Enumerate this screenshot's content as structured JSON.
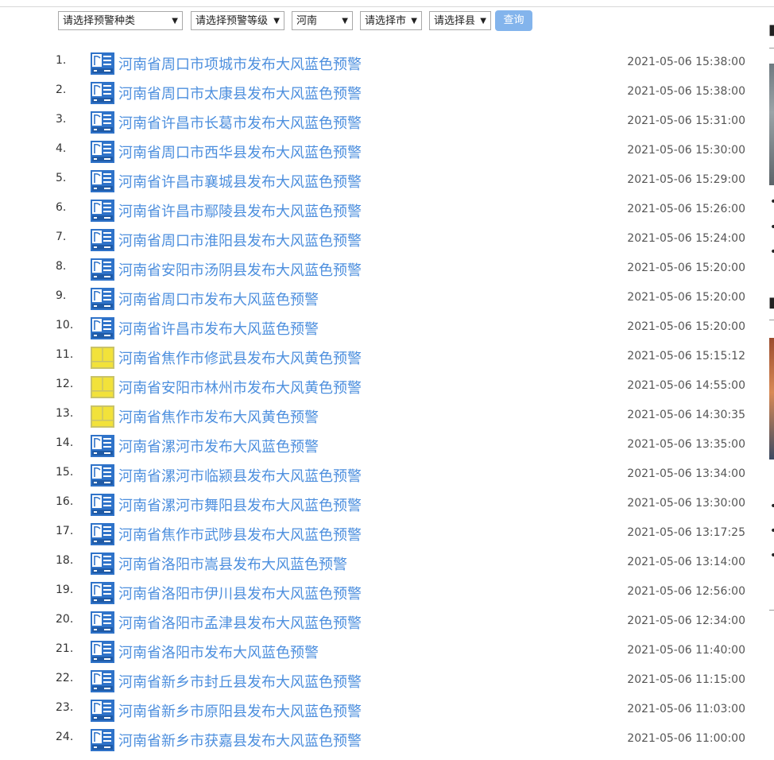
{
  "filters": {
    "type": "请选择预警种类",
    "level": "请选择预警等级",
    "province": "河南",
    "city": "请选择市",
    "county": "请选择县",
    "query_label": "查询"
  },
  "colors": {
    "blue": "#2f73c9",
    "yellow": "#f2e23a",
    "link": "#4d8fde"
  },
  "alerts": [
    {
      "num": "1.",
      "title": "河南省周口市项城市发布大风蓝色预警",
      "time": "2021-05-06 15:38:00",
      "level": "blue"
    },
    {
      "num": "2.",
      "title": "河南省周口市太康县发布大风蓝色预警",
      "time": "2021-05-06 15:38:00",
      "level": "blue"
    },
    {
      "num": "3.",
      "title": "河南省许昌市长葛市发布大风蓝色预警",
      "time": "2021-05-06 15:31:00",
      "level": "blue"
    },
    {
      "num": "4.",
      "title": "河南省周口市西华县发布大风蓝色预警",
      "time": "2021-05-06 15:30:00",
      "level": "blue"
    },
    {
      "num": "5.",
      "title": "河南省许昌市襄城县发布大风蓝色预警",
      "time": "2021-05-06 15:29:00",
      "level": "blue"
    },
    {
      "num": "6.",
      "title": "河南省许昌市鄢陵县发布大风蓝色预警",
      "time": "2021-05-06 15:26:00",
      "level": "blue"
    },
    {
      "num": "7.",
      "title": "河南省周口市淮阳县发布大风蓝色预警",
      "time": "2021-05-06 15:24:00",
      "level": "blue"
    },
    {
      "num": "8.",
      "title": "河南省安阳市汤阴县发布大风蓝色预警",
      "time": "2021-05-06 15:20:00",
      "level": "blue"
    },
    {
      "num": "9.",
      "title": "河南省周口市发布大风蓝色预警",
      "time": "2021-05-06 15:20:00",
      "level": "blue"
    },
    {
      "num": "10.",
      "title": "河南省许昌市发布大风蓝色预警",
      "time": "2021-05-06 15:20:00",
      "level": "blue"
    },
    {
      "num": "11.",
      "title": "河南省焦作市修武县发布大风黄色预警",
      "time": "2021-05-06 15:15:12",
      "level": "yellow"
    },
    {
      "num": "12.",
      "title": "河南省安阳市林州市发布大风黄色预警",
      "time": "2021-05-06 14:55:00",
      "level": "yellow"
    },
    {
      "num": "13.",
      "title": "河南省焦作市发布大风黄色预警",
      "time": "2021-05-06 14:30:35",
      "level": "yellow"
    },
    {
      "num": "14.",
      "title": "河南省漯河市发布大风蓝色预警",
      "time": "2021-05-06 13:35:00",
      "level": "blue"
    },
    {
      "num": "15.",
      "title": "河南省漯河市临颍县发布大风蓝色预警",
      "time": "2021-05-06 13:34:00",
      "level": "blue"
    },
    {
      "num": "16.",
      "title": "河南省漯河市舞阳县发布大风蓝色预警",
      "time": "2021-05-06 13:30:00",
      "level": "blue"
    },
    {
      "num": "17.",
      "title": "河南省焦作市武陟县发布大风蓝色预警",
      "time": "2021-05-06 13:17:25",
      "level": "blue"
    },
    {
      "num": "18.",
      "title": "河南省洛阳市嵩县发布大风蓝色预警",
      "time": "2021-05-06 13:14:00",
      "level": "blue"
    },
    {
      "num": "19.",
      "title": "河南省洛阳市伊川县发布大风蓝色预警",
      "time": "2021-05-06 12:56:00",
      "level": "blue"
    },
    {
      "num": "20.",
      "title": "河南省洛阳市孟津县发布大风蓝色预警",
      "time": "2021-05-06 12:34:00",
      "level": "blue"
    },
    {
      "num": "21.",
      "title": "河南省洛阳市发布大风蓝色预警",
      "time": "2021-05-06 11:40:00",
      "level": "blue"
    },
    {
      "num": "22.",
      "title": "河南省新乡市封丘县发布大风蓝色预警",
      "time": "2021-05-06 11:15:00",
      "level": "blue"
    },
    {
      "num": "23.",
      "title": "河南省新乡市原阳县发布大风蓝色预警",
      "time": "2021-05-06 11:03:00",
      "level": "blue"
    },
    {
      "num": "24.",
      "title": "河南省新乡市获嘉县发布大风蓝色预警",
      "time": "2021-05-06 11:00:00",
      "level": "blue"
    }
  ]
}
